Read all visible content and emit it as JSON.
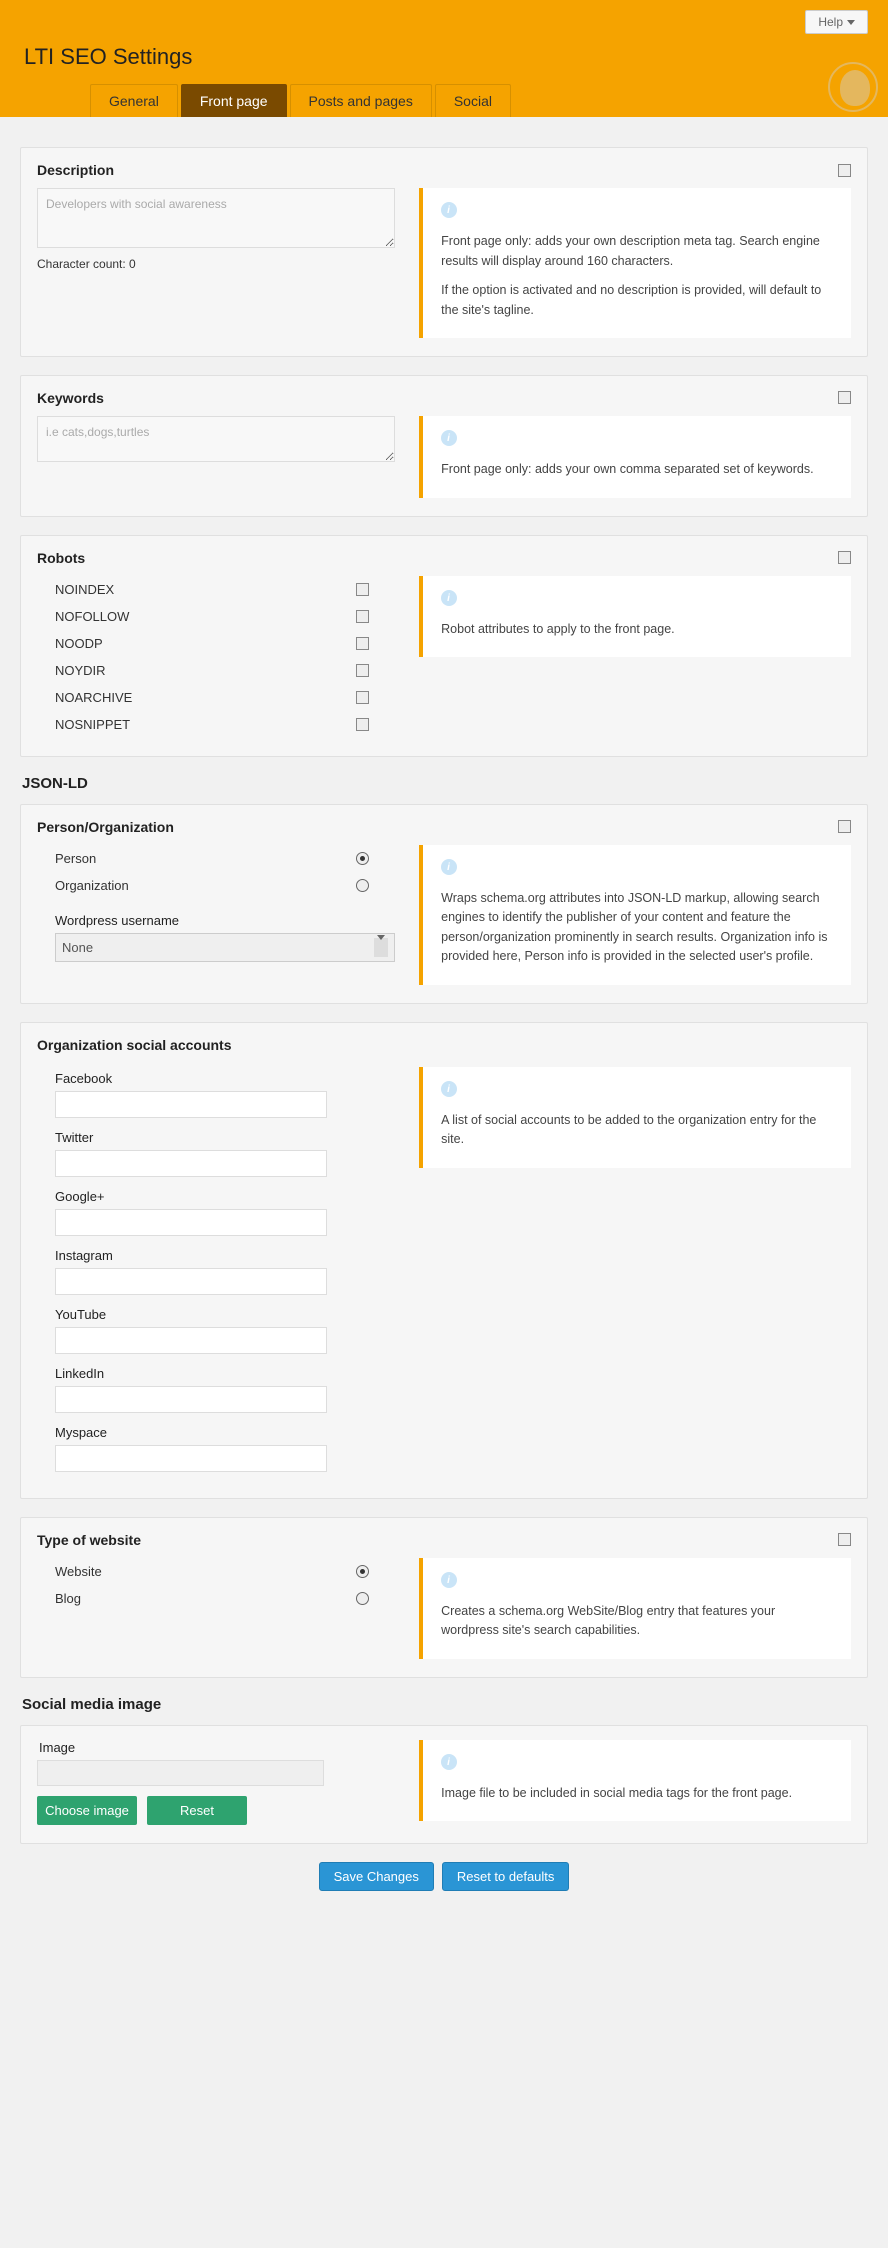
{
  "header": {
    "help_label": "Help",
    "title": "LTI SEO Settings"
  },
  "tabs": {
    "general": "General",
    "front": "Front page",
    "posts": "Posts and pages",
    "social": "Social"
  },
  "description": {
    "title": "Description",
    "placeholder": "Developers with social awareness",
    "charcount_label": "Character count: 0",
    "info1": "Front page only: adds your own description meta tag. Search engine results will display around 160 characters.",
    "info2": "If the option is activated and no description is provided, will default to the site's tagline."
  },
  "keywords": {
    "title": "Keywords",
    "placeholder": "i.e cats,dogs,turtles",
    "info": "Front page only: adds your own comma separated set of keywords."
  },
  "robots": {
    "title": "Robots",
    "info": "Robot attributes to apply to the front page.",
    "items": [
      "NOINDEX",
      "NOFOLLOW",
      "NOODP",
      "NOYDIR",
      "NOARCHIVE",
      "NOSNIPPET"
    ]
  },
  "jsonld": {
    "title": "JSON-LD",
    "po": {
      "title": "Person/Organization",
      "person": "Person",
      "org": "Organization",
      "wp_user_label": "Wordpress username",
      "select_value": "None",
      "info": "Wraps schema.org attributes into JSON-LD markup, allowing search engines to identify the publisher of your content and feature the person/organization prominently in search results. Organization info is provided here, Person info is provided in the selected user's profile."
    },
    "social": {
      "title": "Organization social accounts",
      "info": "A list of social accounts to be added to the organization entry for the site.",
      "fields": [
        "Facebook",
        "Twitter",
        "Google+",
        "Instagram",
        "YouTube",
        "LinkedIn",
        "Myspace"
      ]
    },
    "type": {
      "title": "Type of website",
      "website": "Website",
      "blog": "Blog",
      "info": "Creates a schema.org WebSite/Blog entry that features your wordpress site's search capabilities."
    }
  },
  "smi": {
    "title": "Social media image",
    "image_label": "Image",
    "choose": "Choose image",
    "reset": "Reset",
    "info": "Image file to be included in social media tags for the front page."
  },
  "footer": {
    "save": "Save Changes",
    "reset": "Reset to defaults"
  }
}
